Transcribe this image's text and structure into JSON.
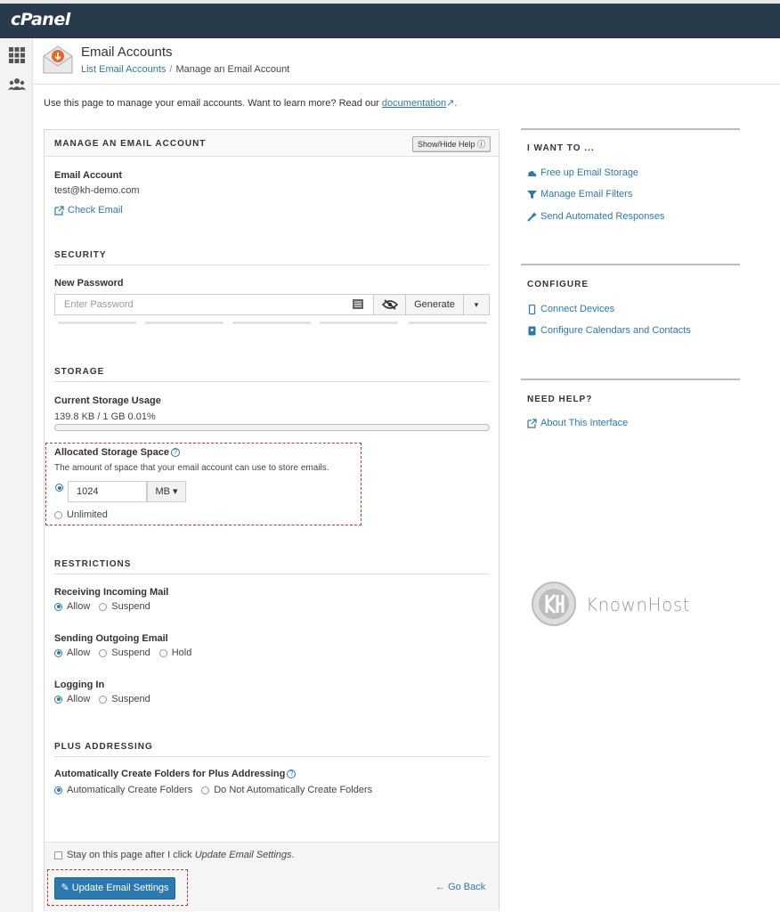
{
  "topbar": {
    "logo": "cPanel"
  },
  "header": {
    "title": "Email Accounts",
    "breadcrumb_link": "List Email Accounts",
    "breadcrumb_sep": "/",
    "breadcrumb_current": "Manage an Email Account"
  },
  "intro": {
    "text": "Use this page to manage your email accounts. Want to learn more? Read our",
    "link": "documentation",
    "suffix": "."
  },
  "panel": {
    "title": "MANAGE AN EMAIL ACCOUNT",
    "help_button": "Show/Hide Help",
    "email_label": "Email Account",
    "email_value": "test@kh-demo.com",
    "check_email": "Check Email"
  },
  "security": {
    "title": "SECURITY",
    "new_password_label": "New Password",
    "password_placeholder": "Enter Password",
    "generate": "Generate"
  },
  "storage": {
    "title": "STORAGE",
    "current_label": "Current Storage Usage",
    "current_value": "139.8 KB / 1 GB 0.01%",
    "usage_fraction": 0.0001,
    "allocated_label": "Allocated Storage Space",
    "allocated_desc": "The amount of space that your email account can use to store emails.",
    "quota_value": "1024",
    "unit": "MB",
    "unlimited": "Unlimited"
  },
  "restrictions": {
    "title": "RESTRICTIONS",
    "receiving_label": "Receiving Incoming Mail",
    "receiving_allow": "Allow",
    "receiving_suspend": "Suspend",
    "sending_label": "Sending Outgoing Email",
    "sending_allow": "Allow",
    "sending_suspend": "Suspend",
    "sending_hold": "Hold",
    "login_label": "Logging In",
    "login_allow": "Allow",
    "login_suspend": "Suspend"
  },
  "plus": {
    "title": "PLUS ADDRESSING",
    "label": "Automatically Create Folders for Plus Addressing",
    "opt_auto": "Automatically Create Folders",
    "opt_none": "Do Not Automatically Create Folders"
  },
  "footer": {
    "stay_prefix": "Stay on this page after I click",
    "stay_em": "Update Email Settings",
    "stay_suffix": ".",
    "update_button": "Update Email Settings",
    "go_back": "Go Back"
  },
  "sidebar": {
    "want_title": "I WANT TO ...",
    "want_links": [
      "Free up Email Storage",
      "Manage Email Filters",
      "Send Automated Responses"
    ],
    "configure_title": "CONFIGURE",
    "configure_links": [
      "Connect Devices",
      "Configure Calendars and Contacts"
    ],
    "help_title": "NEED HELP?",
    "help_links": [
      "About This Interface"
    ]
  },
  "watermark": {
    "text": "KnownHost"
  },
  "colors": {
    "accent": "#2a7ab0",
    "topbar": "#293a4a",
    "highlight": "#c0392b"
  }
}
